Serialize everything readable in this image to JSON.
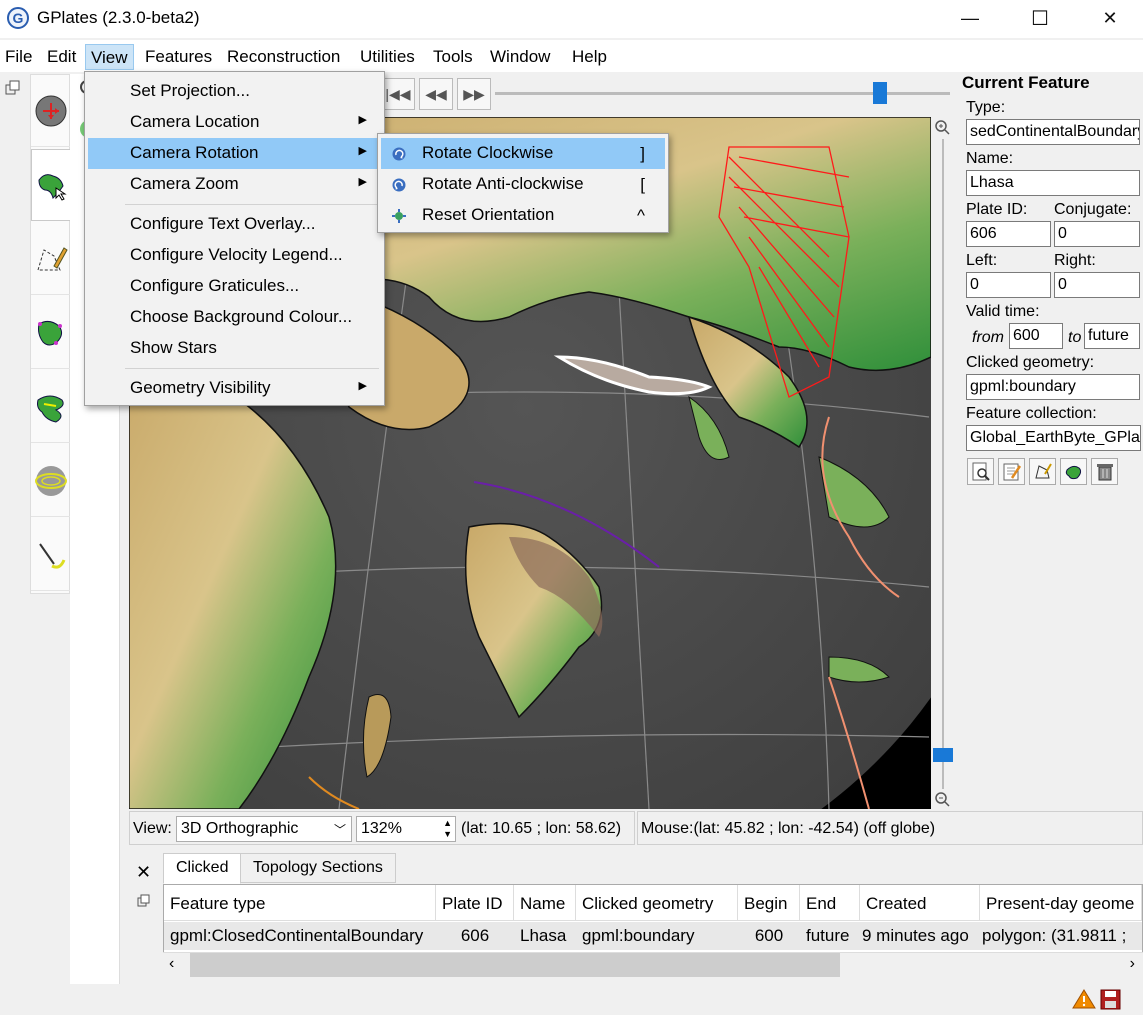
{
  "window": {
    "title": "GPlates (2.3.0-beta2)",
    "minimize": "—",
    "maximize": "☐",
    "close": "✕",
    "app_icon_letter": "G"
  },
  "menubar": [
    "File",
    "Edit",
    "View",
    "Features",
    "Reconstruction",
    "Utilities",
    "Tools",
    "Window",
    "Help"
  ],
  "view_menu": {
    "items": [
      {
        "label": "Set Projection...",
        "submenu": false
      },
      {
        "label": "Camera Location",
        "submenu": true
      },
      {
        "label": "Camera Rotation",
        "submenu": true,
        "highlighted": true
      },
      {
        "label": "Camera Zoom",
        "submenu": true
      },
      {
        "label": "Configure Text Overlay...",
        "submenu": false
      },
      {
        "label": "Configure Velocity Legend...",
        "submenu": false
      },
      {
        "label": "Configure Graticules...",
        "submenu": false
      },
      {
        "label": "Choose Background Colour...",
        "submenu": false
      },
      {
        "label": "Show Stars",
        "submenu": false
      },
      {
        "label": "Geometry Visibility",
        "submenu": true
      }
    ]
  },
  "rotation_submenu": {
    "items": [
      {
        "label": "Rotate Clockwise",
        "shortcut": "]",
        "icon": "rotate-clockwise-icon",
        "highlighted": true
      },
      {
        "label": "Rotate Anti-clockwise",
        "shortcut": "[",
        "icon": "rotate-anticlockwise-icon"
      },
      {
        "label": "Reset Orientation",
        "shortcut": "^",
        "icon": "reset-orientation-icon"
      }
    ]
  },
  "view_status": {
    "label": "View:",
    "projection": "3D Orthographic",
    "zoom": "132%",
    "coords": "(lat: 10.65 ; lon: 58.62)",
    "mouse": "Mouse:(lat: 45.82 ; lon: -42.54) (off globe)"
  },
  "current_feature": {
    "heading": "Current Feature",
    "type_label": "Type:",
    "type_value": "sedContinentalBoundary",
    "name_label": "Name:",
    "name_value": "Lhasa",
    "plate_id_label": "Plate ID:",
    "plate_id_value": "606",
    "conjugate_label": "Conjugate:",
    "conjugate_value": "0",
    "left_label": "Left:",
    "left_value": "0",
    "right_label": "Right:",
    "right_value": "0",
    "valid_time_label": "Valid time:",
    "from_label": "from",
    "from_value": "600",
    "to_label": "to",
    "to_value": "future",
    "clicked_geometry_label": "Clicked geometry:",
    "clicked_geometry_value": "gpml:boundary",
    "feature_collection_label": "Feature collection:",
    "feature_collection_value": "Global_EarthByte_GPlate"
  },
  "bottom_tabs": [
    "Clicked",
    "Topology Sections"
  ],
  "table": {
    "columns": [
      "Feature type",
      "Plate ID",
      "Name",
      "Clicked geometry",
      "Begin",
      "End",
      "Created",
      "Present-day geome"
    ],
    "rows": [
      [
        "gpml:ClosedContinentalBoundary",
        "606",
        "Lhasa",
        "gpml:boundary",
        "600",
        "future",
        "9 minutes ago",
        "polygon: (31.9811 ;"
      ]
    ]
  },
  "colors": {
    "accent": "#1979d7",
    "menu_highlight": "#91c9f7",
    "ocean": "#4a4a4a",
    "space": "#000000"
  }
}
